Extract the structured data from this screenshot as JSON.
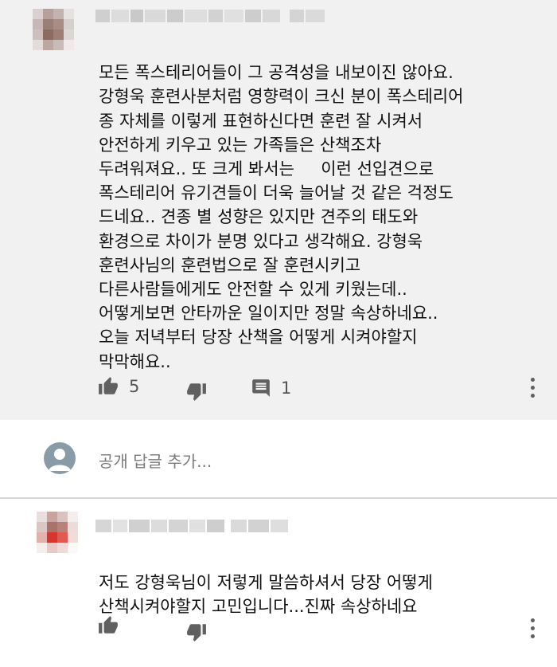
{
  "comments": [
    {
      "text_lines": [
        "모든 폭스테리어들이 그 공격성을 내보이진 않아요.",
        "강형욱 훈련사분처럼 영향력이 크신 분이 폭스테리어",
        "종 자체를 이렇게 표현하신다면 훈련 잘 시켜서",
        "안전하게 키우고 있는 가족들은 산책조차",
        "두려워져요.. 또 크게 봐서는     이런 선입견으로",
        "폭스테리어 유기견들이 더욱 늘어날 것 같은 걱정도",
        "드네요.. 견종 별 성향은 있지만 견주의 태도와",
        "환경으로 차이가 분명 있다고 생각해요. 강형욱",
        "훈련사님의 훈련법으로 잘 훈련시키고",
        "다른사람들에게도 안전할 수 있게 키웠는데..",
        "어떻게보면 안타까운 일이지만 정말 속상하네요..",
        "오늘 저녁부터 당장 산책을 어떻게 시켜야할지",
        "막막해요.."
      ],
      "like_count": "5",
      "reply_count": "1"
    },
    {
      "text_lines": [
        "저도 강형욱님이 저렇게 말씀하셔서 당장 어떻게",
        "산책시켜야할지 고민입니다...진짜 속상하네요"
      ]
    }
  ],
  "reply_box": {
    "placeholder": "공개 답글 추가..."
  },
  "colors": {
    "comment_bg": "#f1f1f1",
    "icon": "#606060",
    "divider": "#d6d6d6"
  },
  "icons": {
    "like": "thumbs-up-icon",
    "dislike": "thumbs-down-icon",
    "reply": "comment-icon",
    "more": "more-vertical-icon",
    "avatar": "default-avatar-icon"
  }
}
